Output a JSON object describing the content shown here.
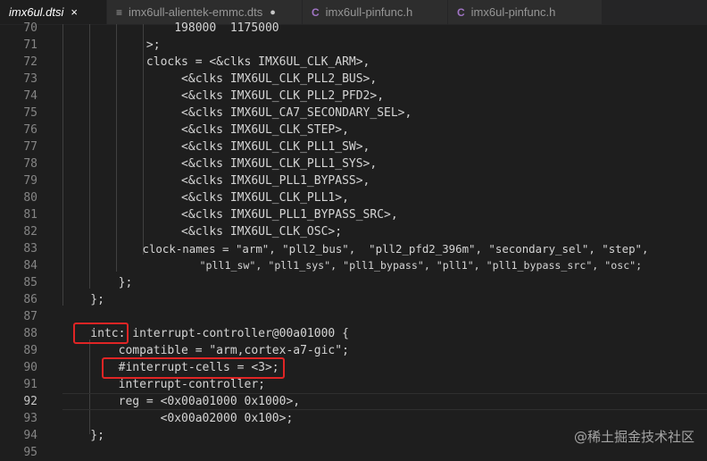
{
  "tabs": [
    {
      "label": "imx6ul.dtsi",
      "icon": "close-icon",
      "active": true
    },
    {
      "label": "imx6ull-alientek-emmc.dts",
      "icon": "dts-file-icon",
      "modified": true
    },
    {
      "label": "imx6ull-pinfunc.h",
      "icon": "c-file-icon"
    },
    {
      "label": "imx6ul-pinfunc.h",
      "icon": "c-file-icon"
    }
  ],
  "tab_close_glyph": "×",
  "tab_dot_glyph": "●",
  "c_icon_glyph": "C",
  "dts_icon_glyph": "≡",
  "lines": [
    {
      "num": "70",
      "text": "                198000  1175000"
    },
    {
      "num": "71",
      "text": "            >;"
    },
    {
      "num": "72",
      "text": "            clocks = <&clks IMX6UL_CLK_ARM>,"
    },
    {
      "num": "73",
      "text": "                 <&clks IMX6UL_CLK_PLL2_BUS>,"
    },
    {
      "num": "74",
      "text": "                 <&clks IMX6UL_CLK_PLL2_PFD2>,"
    },
    {
      "num": "75",
      "text": "                 <&clks IMX6UL_CA7_SECONDARY_SEL>,"
    },
    {
      "num": "76",
      "text": "                 <&clks IMX6UL_CLK_STEP>,"
    },
    {
      "num": "77",
      "text": "                 <&clks IMX6UL_CLK_PLL1_SW>,"
    },
    {
      "num": "78",
      "text": "                 <&clks IMX6UL_CLK_PLL1_SYS>,"
    },
    {
      "num": "79",
      "text": "                 <&clks IMX6UL_PLL1_BYPASS>,"
    },
    {
      "num": "80",
      "text": "                 <&clks IMX6UL_CLK_PLL1>,"
    },
    {
      "num": "81",
      "text": "                 <&clks IMX6UL_PLL1_BYPASS_SRC>,"
    },
    {
      "num": "82",
      "text": "                 <&clks IMX6UL_CLK_OSC>;"
    },
    {
      "num": "83",
      "text": "            clock-names = \"arm\", \"pll2_bus\",  \"pll2_pfd2_396m\", \"secondary_sel\", \"step\","
    },
    {
      "num": "84",
      "text": "                      \"pll1_sw\", \"pll1_sys\", \"pll1_bypass\", \"pll1\", \"pll1_bypass_src\", \"osc\";"
    },
    {
      "num": "85",
      "text": "        };"
    },
    {
      "num": "86",
      "text": "    };"
    },
    {
      "num": "87",
      "text": ""
    },
    {
      "num": "88",
      "text": "    intc: interrupt-controller@00a01000 {"
    },
    {
      "num": "89",
      "text": "        compatible = \"arm,cortex-a7-gic\";"
    },
    {
      "num": "90",
      "text": "        #interrupt-cells = <3>;"
    },
    {
      "num": "91",
      "text": "        interrupt-controller;"
    },
    {
      "num": "92",
      "text": "        reg = <0x00a01000 0x1000>,"
    },
    {
      "num": "93",
      "text": "              <0x00a02000 0x100>;"
    },
    {
      "num": "94",
      "text": "    };"
    },
    {
      "num": "95",
      "text": ""
    }
  ],
  "current_line": "92",
  "watermark": "@稀土掘金技术社区",
  "colors": {
    "background": "#1e1e1e",
    "text": "#d4d4d4",
    "line_number": "#858585",
    "highlight_box": "#e02525"
  }
}
